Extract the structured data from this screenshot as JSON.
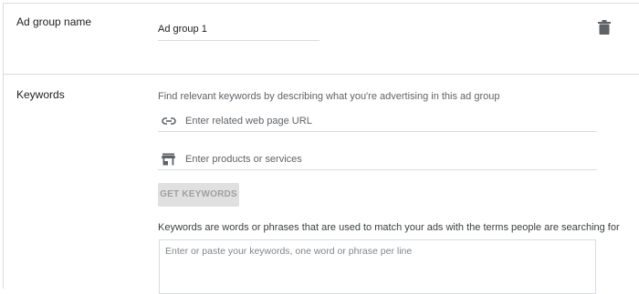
{
  "ad_group": {
    "label": "Ad group name",
    "value": "Ad group 1"
  },
  "keywords": {
    "label": "Keywords",
    "helper": "Find relevant keywords by describing what you're advertising in this ad group",
    "url_placeholder": "Enter related web page URL",
    "products_placeholder": "Enter products or services",
    "get_button": "GET KEYWORDS",
    "description": "Keywords are words or phrases that are used to match your ads with the terms people are searching for",
    "textarea_placeholder": "Enter or paste your keywords, one word or phrase per line"
  },
  "icons": {
    "delete": "trash-icon",
    "url": "link-icon",
    "products": "store-icon"
  },
  "colors": {
    "divider": "#dadce0",
    "secondary_text": "#5f6368",
    "button_disabled_bg": "#e0e0e0",
    "icon": "#5f6368"
  }
}
